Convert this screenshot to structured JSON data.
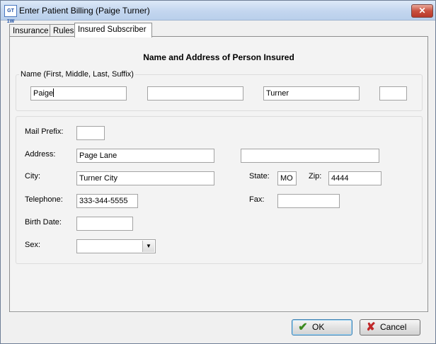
{
  "window": {
    "title": "Enter Patient Billing (Paige Turner)",
    "app_icon_text": "GT 1W",
    "close_glyph": "✕"
  },
  "tabs": [
    {
      "label": "Insurance",
      "active": false
    },
    {
      "label": "Rules",
      "active": false
    },
    {
      "label": "Insured Subscriber",
      "active": true
    }
  ],
  "section_heading": "Name and Address of Person Insured",
  "name_group": {
    "label": "Name (First, Middle, Last, Suffix)",
    "first": "Paige",
    "middle": "",
    "last": "Turner",
    "suffix": ""
  },
  "address_group": {
    "mail_prefix_label": "Mail Prefix:",
    "mail_prefix": "",
    "address_label": "Address:",
    "address_line1": "Page Lane",
    "address_line2": "",
    "city_label": "City:",
    "city": "Turner City",
    "state_label": "State:",
    "state": "MO",
    "zip_label": "Zip:",
    "zip": "4444",
    "telephone_label": "Telephone:",
    "telephone": "333-344-5555",
    "fax_label": "Fax:",
    "fax": "",
    "birth_date_label": "Birth Date:",
    "birth_date": "",
    "sex_label": "Sex:",
    "sex": ""
  },
  "buttons": {
    "ok_label": "OK",
    "ok_icon": "check-icon",
    "cancel_label": "Cancel",
    "cancel_icon": "x-icon"
  },
  "colors": {
    "ok_check": "#3a8a1e",
    "cancel_x": "#c0282a",
    "titlebar": "#c3d6ef"
  }
}
